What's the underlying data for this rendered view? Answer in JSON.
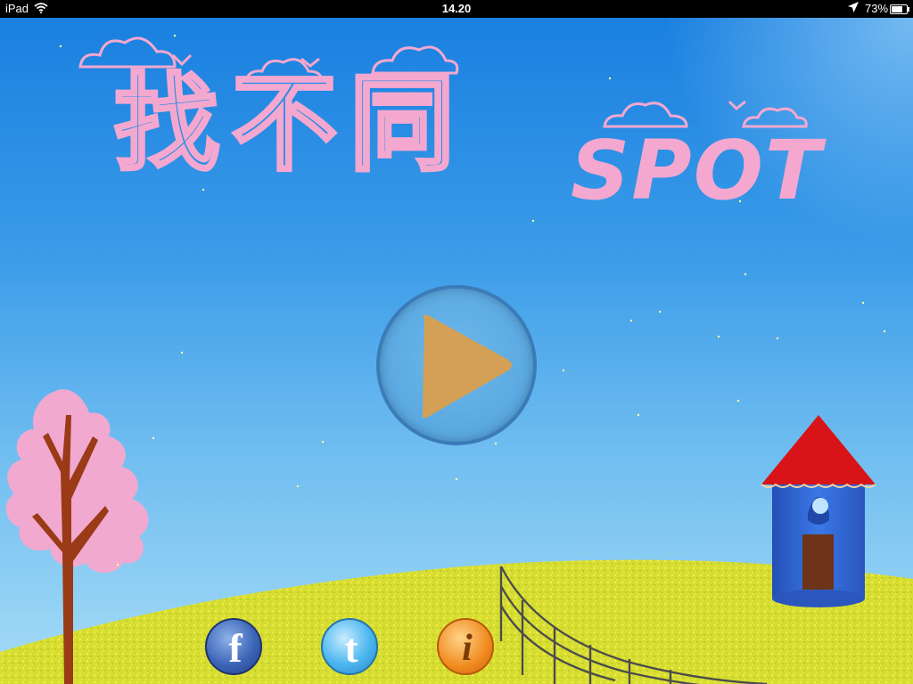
{
  "status_bar": {
    "device": "iPad",
    "time": "14.20",
    "battery_percent": "73%",
    "battery_level": 0.73
  },
  "title": {
    "chinese": "找不同",
    "english": "SPOT"
  },
  "buttons": {
    "play": "play",
    "facebook_glyph": "f",
    "twitter_glyph": "t",
    "info_glyph": "i"
  },
  "colors": {
    "sky_top": "#1a80e0",
    "sky_bottom": "#a6dcf6",
    "title_pink": "#f4a8cf",
    "play_triangle": "#d4a055",
    "grass": "#d8df3a",
    "roof": "#d81418",
    "tower": "#2f67d8",
    "door": "#6e3318",
    "blossom": "#f2a9cf"
  },
  "icons": [
    "wifi-icon",
    "location-arrow-icon",
    "battery-icon",
    "play-icon",
    "facebook-icon",
    "twitter-icon",
    "info-icon"
  ]
}
